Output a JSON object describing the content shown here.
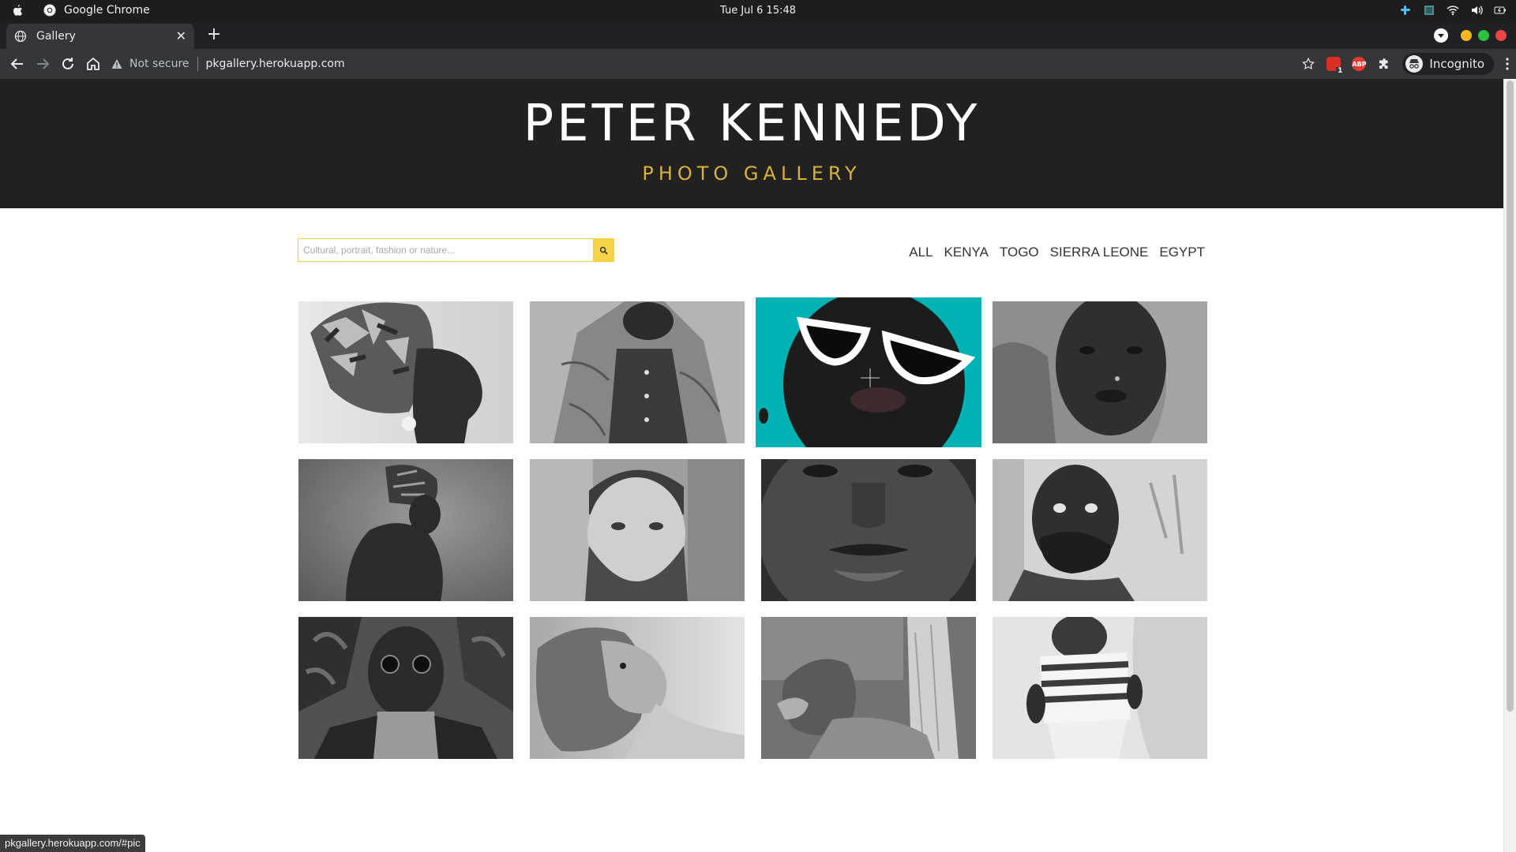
{
  "os": {
    "app_name": "Google Chrome",
    "clock": "Tue Jul 6  15:48"
  },
  "browser": {
    "tab_title": "Gallery",
    "security_label": "Not secure",
    "url": "pkgallery.herokuapp.com",
    "profile_label": "Incognito",
    "status_url": "pkgallery.herokuapp.com/#pic",
    "ext_badge": "1",
    "abp_label": "ABP"
  },
  "site": {
    "title": "PETER KENNEDY",
    "subtitle": "PHOTO GALLERY",
    "search_placeholder": "Cultural, portrait, fashion or nature...",
    "filters": [
      "ALL",
      "KENYA",
      "TOGO",
      "SIERRA LEONE",
      "EGYPT"
    ]
  },
  "colors": {
    "header_bg": "#212121",
    "title": "#ffffff",
    "subtitle": "#d8b23c",
    "search_border": "#f2d24a",
    "search_button": "#f5d547",
    "hover_photo_bg": "#00b2b4"
  },
  "gallery": [
    {
      "subject": "portrait woman headwrap profile",
      "tone": "bw",
      "icon": "photo-woman-headwrap"
    },
    {
      "subject": "fashion man patterned shirt",
      "tone": "bw",
      "icon": "photo-fashion-shirt"
    },
    {
      "subject": "man white cat-eye sunglasses",
      "tone": "color-teal",
      "hover": true,
      "icon": "photo-sunglasses"
    },
    {
      "subject": "woman hood portrait",
      "tone": "bw",
      "icon": "photo-woman-hood"
    },
    {
      "subject": "woman headwrap bare back",
      "tone": "bw",
      "icon": "photo-woman-back"
    },
    {
      "subject": "bearded man portrait",
      "tone": "bw",
      "icon": "photo-bearded-man"
    },
    {
      "subject": "man face close-up wet",
      "tone": "bw",
      "icon": "photo-face-closeup"
    },
    {
      "subject": "child covering mouth",
      "tone": "bw",
      "icon": "photo-child"
    },
    {
      "subject": "man sunglasses turtleneck",
      "tone": "bw",
      "icon": "photo-man-turtleneck"
    },
    {
      "subject": "lion lying",
      "tone": "bw",
      "icon": "photo-lion"
    },
    {
      "subject": "lion by tree",
      "tone": "bw",
      "icon": "photo-lion-tree"
    },
    {
      "subject": "baby striped shirt",
      "tone": "bw",
      "icon": "photo-baby"
    }
  ]
}
